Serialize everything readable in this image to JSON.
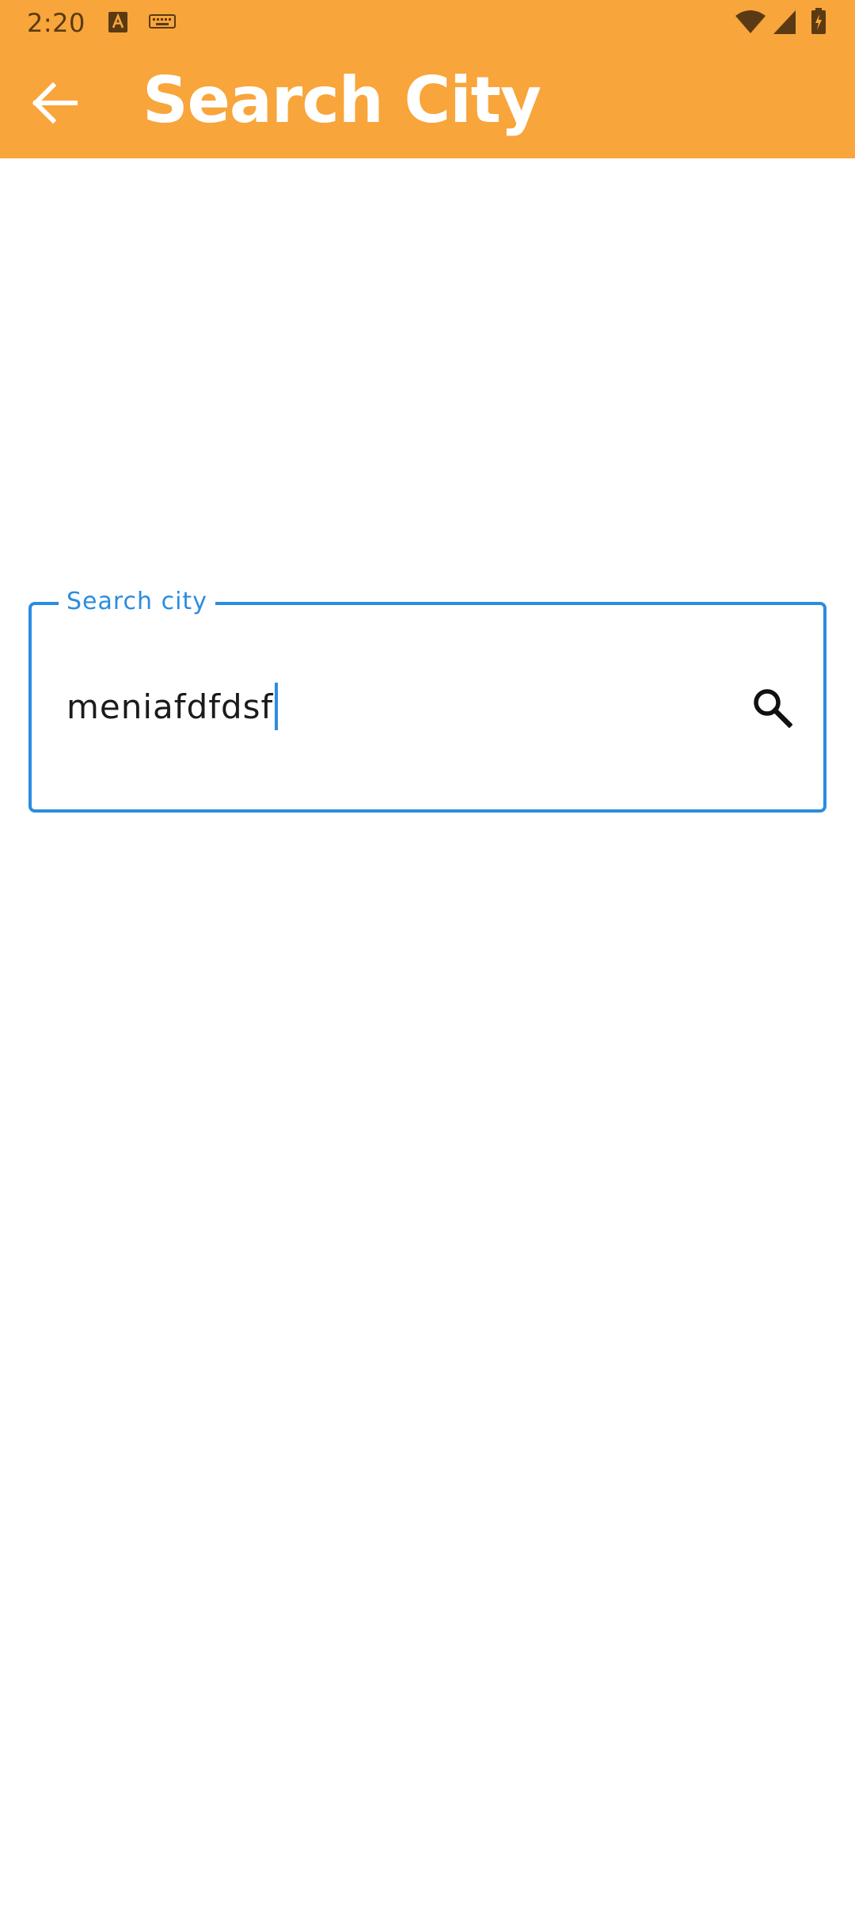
{
  "status_bar": {
    "time": "2:20",
    "icons": [
      "text-a-notification-icon",
      "keyboard-icon",
      "wifi-icon",
      "cell-signal-icon",
      "battery-charging-icon"
    ]
  },
  "app_bar": {
    "title": "Search City",
    "back_icon": "arrow-back-icon",
    "background_color": "#F8A53B"
  },
  "search": {
    "label": "Search city",
    "value": "meniafdfdsf",
    "search_icon": "search-icon",
    "accent_color": "#2B8CE0"
  }
}
